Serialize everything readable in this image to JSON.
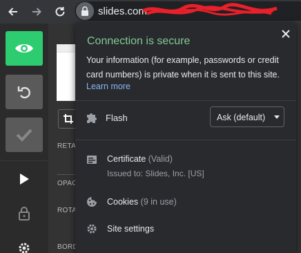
{
  "browser": {
    "url_host": "slides.com",
    "url_path_redacted": "/… (redacted)"
  },
  "editor": {
    "panel_labels": [
      "RETA",
      "OPAC",
      "ROTA",
      "BORDER"
    ]
  },
  "popup": {
    "title": "Connection is secure",
    "description": "Your information (for example, passwords or credit card numbers) is private when it is sent to this site.",
    "learn_more": "Learn more",
    "flash": {
      "label": "Flash",
      "select_value": "Ask (default)"
    },
    "certificate": {
      "label": "Certificate",
      "status": "(Valid)",
      "issued_to": "Issued to: Slides, Inc. [US]"
    },
    "cookies": {
      "label": "Cookies",
      "count": "(9 in use)"
    },
    "site_settings": {
      "label": "Site settings"
    }
  },
  "colors": {
    "secure_green": "#81c995",
    "link_blue": "#8ab4f8",
    "view_button": "#2ecc71",
    "popup_bg": "#292a2d"
  },
  "icons": [
    "back-arrow-icon",
    "forward-arrow-icon",
    "reload-icon",
    "lock-icon",
    "close-icon",
    "puzzle-icon",
    "certificate-icon",
    "cookie-icon",
    "gear-icon",
    "eye-icon",
    "undo-icon",
    "check-icon",
    "play-icon",
    "padlock-icon",
    "crop-icon"
  ]
}
